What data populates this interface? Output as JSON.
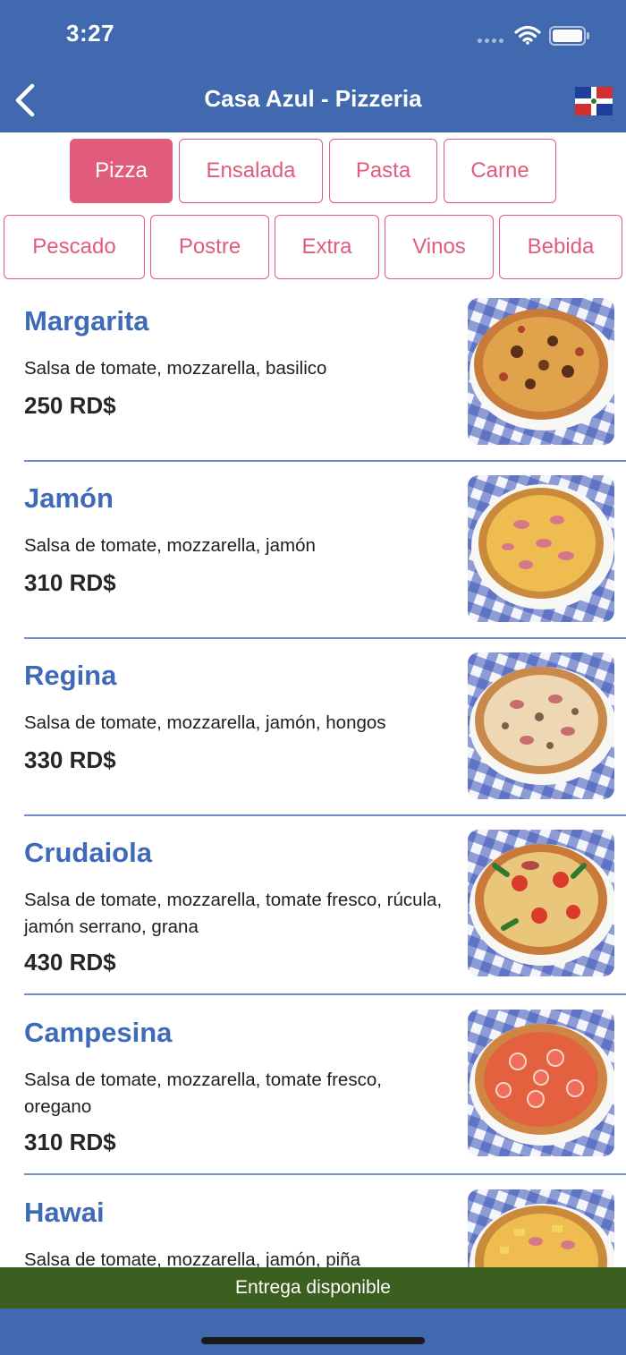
{
  "status_bar": {
    "time": "3:27"
  },
  "nav": {
    "title": "Casa Azul - Pizzeria",
    "back_icon": "chevron-left-icon",
    "flag_icon": "dominican-republic-flag-icon"
  },
  "colors": {
    "header": "#4169b0",
    "accent": "#e05c7a",
    "item_title": "#3f6ab8",
    "delivery_bar": "#3a5f1f"
  },
  "categories": {
    "row1": [
      {
        "label": "Pizza",
        "selected": true
      },
      {
        "label": "Ensalada",
        "selected": false
      },
      {
        "label": "Pasta",
        "selected": false
      },
      {
        "label": "Carne",
        "selected": false
      }
    ],
    "row2": [
      {
        "label": "Pescado",
        "selected": false
      },
      {
        "label": "Postre",
        "selected": false
      },
      {
        "label": "Extra",
        "selected": false
      },
      {
        "label": "Vinos",
        "selected": false
      },
      {
        "label": "Bebida",
        "selected": false
      }
    ]
  },
  "menu_items": [
    {
      "name": "Margarita",
      "description": "Salsa de tomate, mozzarella, basilico",
      "price": "250 RD$"
    },
    {
      "name": "Jamón",
      "description": "Salsa de tomate, mozzarella, jamón",
      "price": "310 RD$"
    },
    {
      "name": "Regina",
      "description": "Salsa de tomate, mozzarella, jamón, hongos",
      "price": "330 RD$"
    },
    {
      "name": "Crudaiola",
      "description": "Salsa de tomate, mozzarella, tomate fresco, rúcula, jamón serrano, grana",
      "price": "430 RD$"
    },
    {
      "name": "Campesina",
      "description": "Salsa de tomate, mozzarella, tomate fresco, oregano",
      "price": "310 RD$"
    },
    {
      "name": "Hawai",
      "description": "Salsa de tomate, mozzarella, jamón, piña",
      "price": ""
    }
  ],
  "footer": {
    "delivery": "Entrega disponible"
  }
}
